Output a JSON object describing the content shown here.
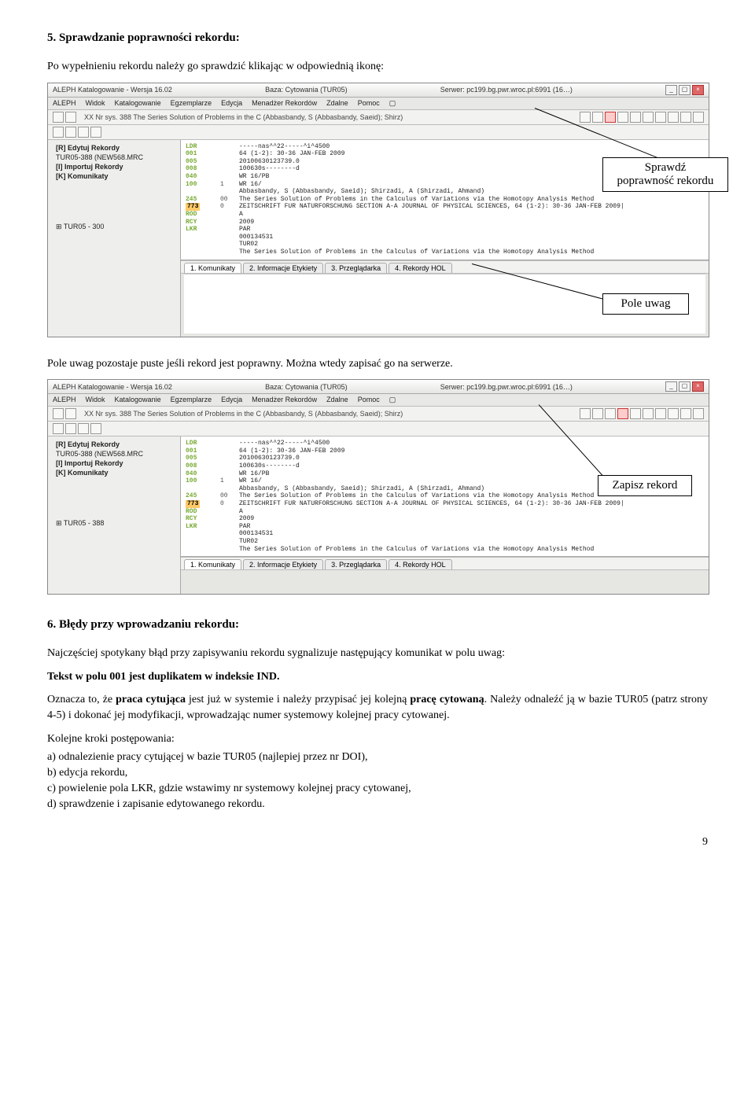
{
  "section5": {
    "title": "5. Sprawdzanie poprawności rekordu:",
    "intro": "Po wypełnieniu rekordu należy go sprawdzić klikając w odpowiednią ikonę:",
    "paragraph2": "Pole uwag pozostaje puste jeśli rekord jest poprawny. Można wtedy zapisać go na serwerze."
  },
  "screenshot1": {
    "title_left": "ALEPH Katalogowanie - Wersja 16.02",
    "title_mid": "Baza:  Cytowania (TUR05)",
    "title_right": "Serwer:  pc199.bg.pwr.wroc.pl:6991 (16…)",
    "menu": [
      "ALEPH",
      "Widok",
      "Katalogowanie",
      "Egzemplarze",
      "Edycja",
      "Menadżer Rekordów",
      "Zdalne",
      "Pomoc",
      "▢"
    ],
    "secondbar": "XX Nr sys. 388 The Series Solution of Problems in the C (Abbasbandy, S (Abbasbandy, Saeid); Shirz)",
    "tree": [
      "[R] Edytuj Rekordy",
      "  TUR05-388 (NEW568.MRC",
      "[I] Importuj Rekordy",
      "[K] Komunikaty",
      "",
      "⊞  TUR05 - 300"
    ],
    "record": [
      [
        "LDR",
        "",
        "-----nas^^22-----^i^4500"
      ],
      [
        "001",
        "",
        "64 (1-2): 30-36 JAN-FEB 2009"
      ],
      [
        "005",
        "",
        "20100630123739.0"
      ],
      [
        "008",
        "",
        "100630s--------d"
      ],
      [
        "040",
        "",
        "WR 16/PB"
      ],
      [
        "100",
        "1",
        "WR 16/"
      ],
      [
        "",
        "",
        "Abbasbandy, S (Abbasbandy, Saeid); Shirzadi, A (Shirzadi, Ahmand)"
      ],
      [
        "245",
        "00",
        "The Series Solution of Problems in the Calculus of Variations via the Homotopy Analysis Method"
      ],
      [
        "773",
        "0",
        "ZEITSCHRIFT FUR NATURFORSCHUNG SECTION A-A JOURNAL OF PHYSICAL SCIENCES, 64 (1-2): 30-36 JAN-FEB 2009|"
      ],
      [
        "ROD",
        "",
        "A"
      ],
      [
        "RCY",
        "",
        "2009"
      ],
      [
        "LKR",
        "",
        "PAR"
      ],
      [
        "",
        "",
        "000134531"
      ],
      [
        "",
        "",
        "TUR02"
      ],
      [
        "",
        "",
        "The Series Solution of Problems in the Calculus of Variations via the Homotopy Analysis Method"
      ]
    ],
    "tabs": [
      "1. Komunikaty",
      "2. Informacje Etykiety",
      "3. Przeglądarka",
      "4. Rekordy HOL"
    ],
    "callout1": "Sprawdź\npoprawność rekordu",
    "callout2": "Pole uwag"
  },
  "screenshot2": {
    "title_left": "ALEPH Katalogowanie - Wersja 16.02",
    "title_mid": "Baza:  Cytowania (TUR05)",
    "title_right": "Serwer:  pc199.bg.pwr.wroc.pl:6991 (16…)",
    "menu": [
      "ALEPH",
      "Widok",
      "Katalogowanie",
      "Egzemplarze",
      "Edycja",
      "Menadżer Rekordów",
      "Zdalne",
      "Pomoc",
      "▢"
    ],
    "secondbar": "XX Nr sys. 388 The Series Solution of Problems in the C (Abbasbandy, S (Abbasbandy, Saeid); Shirz)",
    "tree": [
      "[R] Edytuj Rekordy",
      "  TUR05-388 (NEW568.MRC",
      "[I] Importuj Rekordy",
      "[K] Komunikaty",
      "",
      "⊞  TUR05 - 388"
    ],
    "record": [
      [
        "LDR",
        "",
        "-----nas^^22-----^i^4500"
      ],
      [
        "001",
        "",
        "64 (1-2): 30-36 JAN-FEB 2009"
      ],
      [
        "005",
        "",
        "20100630123739.0"
      ],
      [
        "008",
        "",
        "100630s--------d"
      ],
      [
        "040",
        "",
        "WR 16/PB"
      ],
      [
        "100",
        "1",
        "WR 16/"
      ],
      [
        "",
        "",
        "Abbasbandy, S (Abbasbandy, Saeid); Shirzadi, A (Shirzadi, Ahmand)"
      ],
      [
        "245",
        "00",
        "The Series Solution of Problems in the Calculus of Variations via the Homotopy Analysis Method"
      ],
      [
        "773",
        "0",
        "ZEITSCHRIFT FUR NATURFORSCHUNG SECTION A-A JOURNAL OF PHYSICAL SCIENCES, 64 (1-2): 30-36 JAN-FEB 2009|"
      ],
      [
        "ROD",
        "",
        "A"
      ],
      [
        "RCY",
        "",
        "2009"
      ],
      [
        "LKR",
        "",
        "PAR"
      ],
      [
        "",
        "",
        "000134531"
      ],
      [
        "",
        "",
        "TUR02"
      ],
      [
        "",
        "",
        "The Series Solution of Problems in the Calculus of Variations via the Homotopy Analysis Method"
      ]
    ],
    "tabs": [
      "1. Komunikaty",
      "2. Informacje Etykiety",
      "3. Przeglądarka",
      "4. Rekordy HOL"
    ],
    "callout": "Zapisz rekord"
  },
  "section6": {
    "title": "6. Błędy przy wprowadzaniu rekordu:",
    "p1": "Najczęściej spotykany błąd przy zapisywaniu rekordu sygnalizuje następujący komunikat w polu uwag:",
    "p2": "Tekst w polu 001 jest duplikatem w indeksie IND.",
    "p3a": "Oznacza to, że ",
    "p3b": "praca cytująca",
    "p3c": " jest już w systemie i należy przypisać jej kolejną ",
    "p3d": "pracę cytowaną",
    "p3e": ". Należy odnaleźć ją w bazie TUR05 (patrz strony 4-5) i dokonać jej modyfikacji, wprowadzając numer systemowy kolejnej pracy cytowanej.",
    "p4": "Kolejne kroki postępowania:",
    "steps": [
      "a)   odnalezienie pracy cytującej w bazie TUR05 (najlepiej przez nr DOI),",
      "b)   edycja rekordu,",
      "c)   powielenie pola LKR, gdzie wstawimy nr systemowy kolejnej pracy cytowanej,",
      "d)   sprawdzenie i zapisanie edytowanego rekordu."
    ]
  },
  "page_number": "9"
}
